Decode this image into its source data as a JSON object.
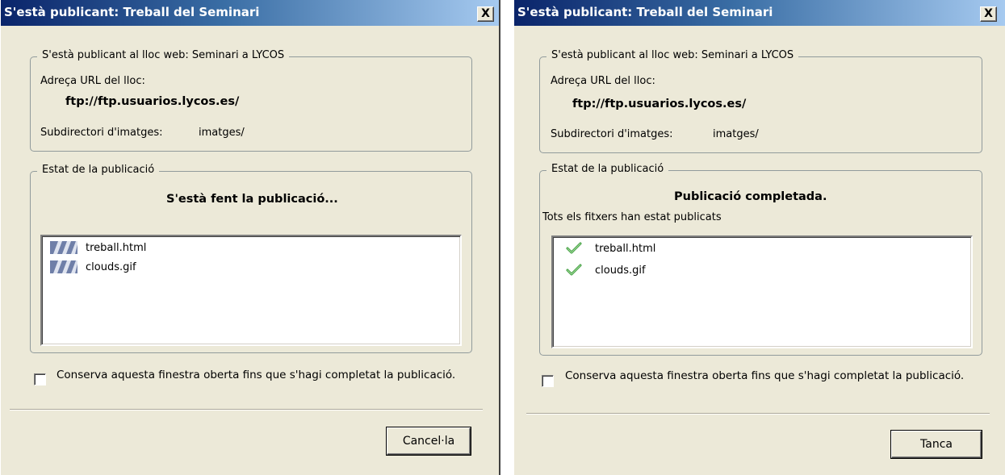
{
  "left_dialog": {
    "title": "S'està publicant: Treball del Seminari",
    "close_label": "X",
    "site_group_legend": "S'està publicant al lloc web: Seminari a LYCOS",
    "url_label": "Adreça URL del lloc:",
    "url_value": "ftp://ftp.usuarios.lycos.es/",
    "images_label": "Subdirectori d'imatges:",
    "images_value": "imatges/",
    "status_legend": "Estat de la publicació",
    "status_text": "S'està fent la publicació...",
    "files": [
      {
        "name": "treball.html",
        "icon": "in-progress-icon"
      },
      {
        "name": "clouds.gif",
        "icon": "in-progress-icon"
      }
    ],
    "keep_open_label": "Conserva aquesta finestra oberta fins que s'hagi completat la publicació.",
    "button_label": "Cancel·la"
  },
  "right_dialog": {
    "title": "S'està publicant: Treball del Seminari",
    "close_label": "X",
    "site_group_legend": "S'està publicant al lloc web: Seminari a LYCOS",
    "url_label": "Adreça URL del lloc:",
    "url_value": "ftp://ftp.usuarios.lycos.es/",
    "images_label": "Subdirectori d'imatges:",
    "images_value": "imatges/",
    "status_legend": "Estat de la publicació",
    "status_text": "Publicació completada.",
    "status_subtext": "Tots els fitxers han estat publicats",
    "files": [
      {
        "name": "treball.html",
        "icon": "check-icon"
      },
      {
        "name": "clouds.gif",
        "icon": "check-icon"
      }
    ],
    "keep_open_label": "Conserva aquesta finestra oberta fins que s'hagi completat la publicació.",
    "button_label": "Tanca"
  },
  "colors": {
    "titlebar_start": "#0a246a",
    "titlebar_end": "#a6caf0",
    "dialog_bg": "#ece9d8",
    "check_green": "#3c9a3c"
  }
}
